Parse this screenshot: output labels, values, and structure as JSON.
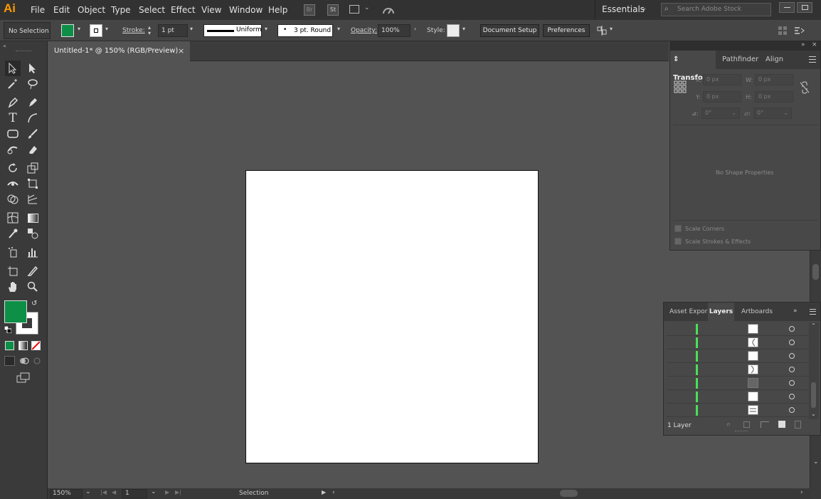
{
  "app": {
    "logo": "Ai"
  },
  "menu": [
    "File",
    "Edit",
    "Object",
    "Type",
    "Select",
    "Effect",
    "View",
    "Window",
    "Help"
  ],
  "menubar_right": {
    "bridge": "Br",
    "stock": "St",
    "workspace": "Essentials",
    "search_placeholder": "Search Adobe Stock"
  },
  "control": {
    "selection_label": "No Selection",
    "stroke_label": "Stroke:",
    "stroke_weight": "1 pt",
    "profile": "Uniform",
    "brush": "3 pt. Round",
    "opacity_label": "Opacity:",
    "opacity": "100%",
    "style_label": "Style:",
    "document_setup": "Document Setup",
    "preferences": "Preferences",
    "fill_color": "#0d8f47"
  },
  "document": {
    "tab_title": "Untitled-1* @ 150% (RGB/Preview)",
    "close": "×"
  },
  "status": {
    "zoom": "150%",
    "artboard": "1",
    "tool": "Selection"
  },
  "transform_panel": {
    "tabs": [
      "Transform",
      "Pathfinder",
      "Align"
    ],
    "x_label": "X:",
    "x_val": "0 px",
    "y_label": "Y:",
    "y_val": "0 px",
    "w_label": "W:",
    "w_val": "0 px",
    "h_label": "H:",
    "h_val": "0 px",
    "angle": "0°",
    "shear": "0°",
    "empty": "No Shape Properties",
    "scale_corners": "Scale Corners",
    "scale_strokes": "Scale Strokes & Effects"
  },
  "layers_panel": {
    "tabs": [
      "Asset Expor",
      "Layers",
      "Artboards"
    ],
    "count": "1 Layer",
    "rows": 7
  },
  "colors": {
    "fill": "#0d8f47",
    "accent_green": "#4be058",
    "stroke": "#ffffff"
  }
}
